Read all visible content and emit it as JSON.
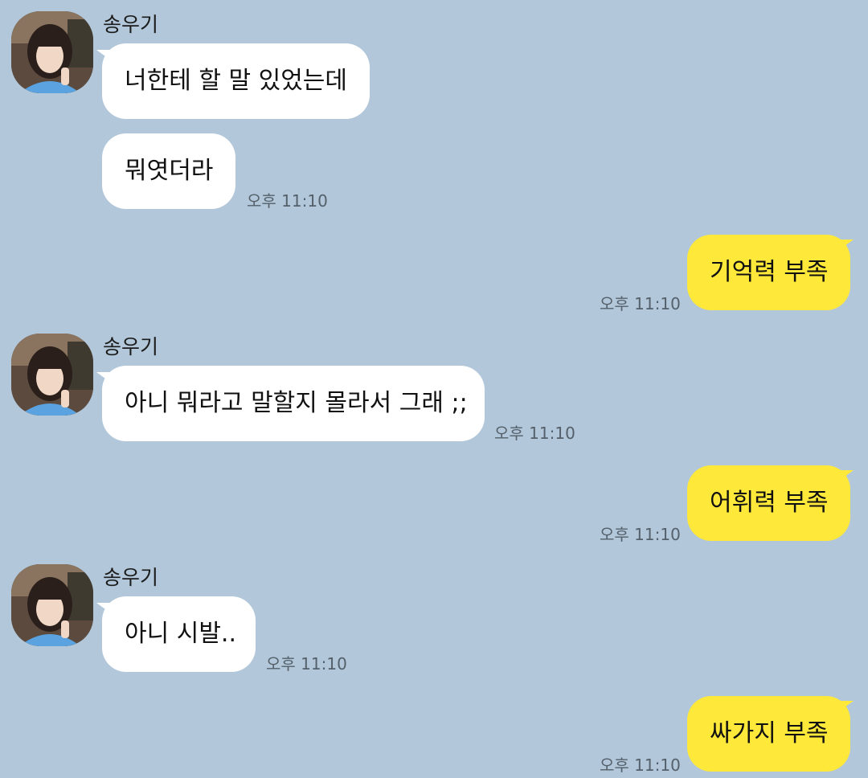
{
  "chat": {
    "colors": {
      "background": "#b2c7d9",
      "incoming_bubble": "#ffffff",
      "outgoing_bubble": "#fee83a",
      "timestamp": "#54606b"
    },
    "groups": [
      {
        "sender": "송우기",
        "avatar_icon": "profile-photo-icon",
        "messages": [
          "너한테 할 말 있었는데",
          "뭐엿더라"
        ],
        "time": "오후 11:10"
      },
      {
        "outgoing": true,
        "messages": [
          "기억력 부족"
        ],
        "time": "오후 11:10"
      },
      {
        "sender": "송우기",
        "avatar_icon": "profile-photo-icon",
        "messages": [
          "아니 뭐라고 말할지 몰라서 그래 ;;"
        ],
        "time": "오후 11:10"
      },
      {
        "outgoing": true,
        "messages": [
          "어휘력 부족"
        ],
        "time": "오후 11:10"
      },
      {
        "sender": "송우기",
        "avatar_icon": "profile-photo-icon",
        "messages": [
          "아니 시발.."
        ],
        "time": "오후 11:10"
      },
      {
        "outgoing": true,
        "messages": [
          "싸가지 부족"
        ],
        "time": "오후 11:10"
      }
    ]
  }
}
